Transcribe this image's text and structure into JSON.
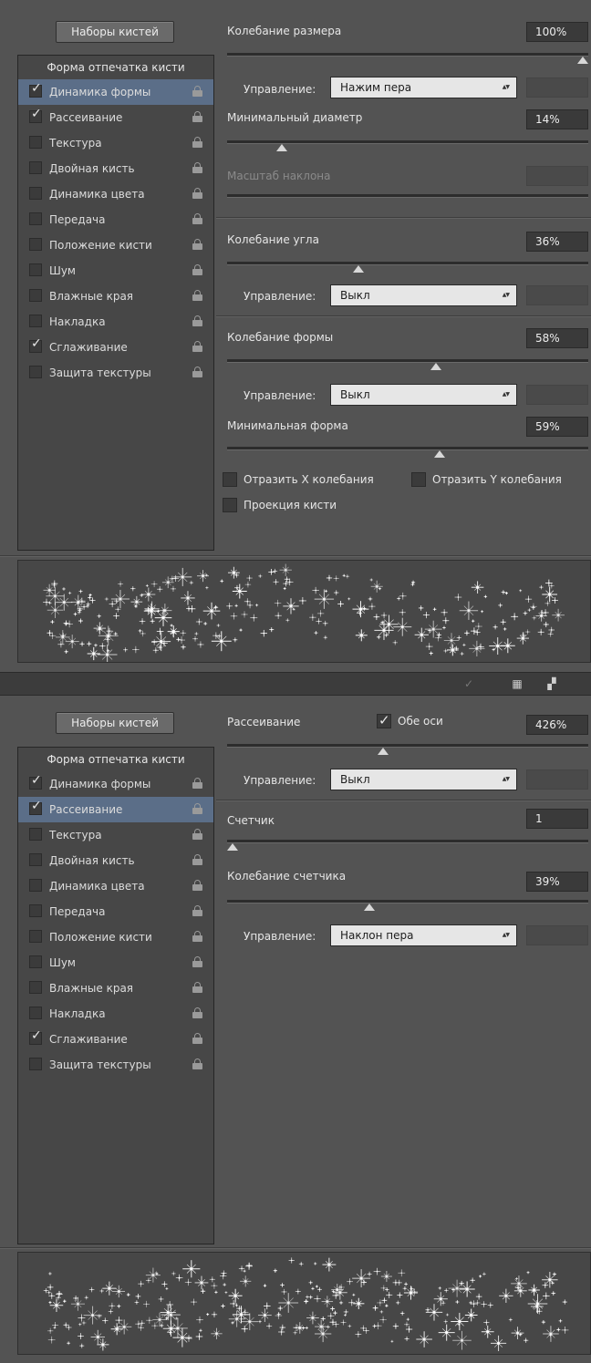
{
  "panel1": {
    "presets_button": "Наборы кистей",
    "list_header": "Форма отпечатка кисти",
    "items": [
      {
        "label": "Динамика формы",
        "checked": true,
        "selected": true
      },
      {
        "label": "Рассеивание",
        "checked": true,
        "selected": false
      },
      {
        "label": "Текстура",
        "checked": false,
        "selected": false
      },
      {
        "label": "Двойная кисть",
        "checked": false,
        "selected": false
      },
      {
        "label": "Динамика цвета",
        "checked": false,
        "selected": false
      },
      {
        "label": "Передача",
        "checked": false,
        "selected": false
      },
      {
        "label": "Положение кисти",
        "checked": false,
        "selected": false
      },
      {
        "label": "Шум",
        "checked": false,
        "selected": false
      },
      {
        "label": "Влажные края",
        "checked": false,
        "selected": false
      },
      {
        "label": "Накладка",
        "checked": false,
        "selected": false
      },
      {
        "label": "Сглаживание",
        "checked": true,
        "selected": false
      },
      {
        "label": "Защита текстуры",
        "checked": false,
        "selected": false
      }
    ],
    "size_jitter": {
      "label": "Колебание размера",
      "value": "100%",
      "level": 1.0
    },
    "control1": {
      "label": "Управление:",
      "value": "Нажим пера"
    },
    "min_diameter": {
      "label": "Минимальный диаметр",
      "value": "14%",
      "level": 0.14
    },
    "tilt_scale": {
      "label": "Масштаб наклона"
    },
    "angle_jitter": {
      "label": "Колебание угла",
      "value": "36%",
      "level": 0.36
    },
    "control2": {
      "label": "Управление:",
      "value": "Выкл"
    },
    "roundness_jitter": {
      "label": "Колебание формы",
      "value": "58%",
      "level": 0.58
    },
    "control3": {
      "label": "Управление:",
      "value": "Выкл"
    },
    "min_roundness": {
      "label": "Минимальная форма",
      "value": "59%",
      "level": 0.59
    },
    "flip_x": {
      "label": "Отразить X колебания",
      "checked": false
    },
    "flip_y": {
      "label": "Отразить Y колебания",
      "checked": false
    },
    "projection": {
      "label": "Проекция кисти",
      "checked": false
    }
  },
  "panel2": {
    "presets_button": "Наборы кистей",
    "list_header": "Форма отпечатка кисти",
    "items": [
      {
        "label": "Динамика формы",
        "checked": true,
        "selected": false
      },
      {
        "label": "Рассеивание",
        "checked": true,
        "selected": true
      },
      {
        "label": "Текстура",
        "checked": false,
        "selected": false
      },
      {
        "label": "Двойная кисть",
        "checked": false,
        "selected": false
      },
      {
        "label": "Динамика цвета",
        "checked": false,
        "selected": false
      },
      {
        "label": "Передача",
        "checked": false,
        "selected": false
      },
      {
        "label": "Положение кисти",
        "checked": false,
        "selected": false
      },
      {
        "label": "Шум",
        "checked": false,
        "selected": false
      },
      {
        "label": "Влажные края",
        "checked": false,
        "selected": false
      },
      {
        "label": "Накладка",
        "checked": false,
        "selected": false
      },
      {
        "label": "Сглаживание",
        "checked": true,
        "selected": false
      },
      {
        "label": "Защита текстуры",
        "checked": false,
        "selected": false
      }
    ],
    "scatter": {
      "label": "Рассеивание",
      "value": "426%",
      "level": 0.43
    },
    "both_axes": {
      "label": "Обе оси",
      "checked": true
    },
    "control1": {
      "label": "Управление:",
      "value": "Выкл"
    },
    "count": {
      "label": "Счетчик",
      "value": "1",
      "level": 0.0
    },
    "count_jitter": {
      "label": "Колебание счетчика",
      "value": "39%",
      "level": 0.39
    },
    "control2": {
      "label": "Управление:",
      "value": "Наклон пера"
    }
  },
  "divider_icons": [
    "brush-pose-icon",
    "grid-panel-icon",
    "new-preset-icon"
  ],
  "colors": {
    "panel": "#535353",
    "list": "#474747",
    "selected": "#5b6e88"
  }
}
